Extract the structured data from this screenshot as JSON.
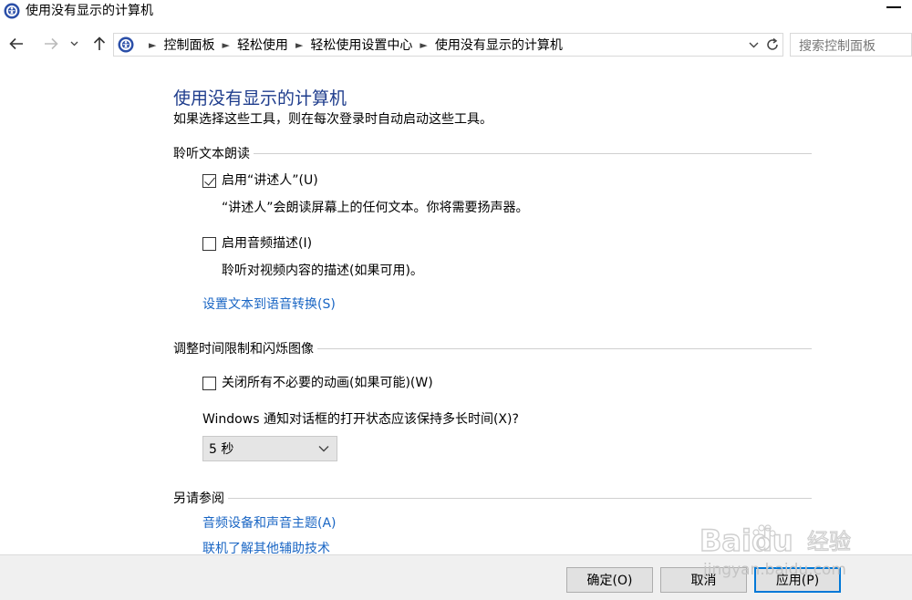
{
  "window": {
    "title": "使用没有显示的计算机"
  },
  "nav": {
    "breadcrumbs": [
      "控制面板",
      "轻松使用",
      "轻松使用设置中心",
      "使用没有显示的计算机"
    ],
    "search_placeholder": "搜索控制面板"
  },
  "page": {
    "title": "使用没有显示的计算机",
    "subtitle": "如果选择这些工具，则在每次登录时自动启动这些工具。"
  },
  "sections": {
    "hear": {
      "heading": "聆听文本朗读",
      "narrator_label": "启用“讲述人”(U)",
      "narrator_checked": true,
      "narrator_desc": "“讲述人”会朗读屏幕上的任何文本。你将需要扬声器。",
      "audio_desc_label": "启用音频描述(I)",
      "audio_desc_checked": false,
      "audio_desc_desc": "聆听对视频内容的描述(如果可用)。",
      "tts_link": "设置文本到语音转换(S)"
    },
    "timing": {
      "heading": "调整时间限制和闪烁图像",
      "animations_label": "关闭所有不必要的动画(如果可能)(W)",
      "animations_checked": false,
      "notify_question": "Windows 通知对话框的打开状态应该保持多长时间(X)?",
      "notify_value": "5 秒"
    },
    "see_also": {
      "heading": "另请参阅",
      "link1": "音频设备和声音主题(A)",
      "link2": "联机了解其他辅助技术"
    }
  },
  "buttons": {
    "ok": "确定(O)",
    "cancel": "取消",
    "apply": "应用(P)"
  },
  "watermark": {
    "brand": "Baidu",
    "brand_cn": "经验",
    "url": "jingyan.baidu.com"
  },
  "colors": {
    "title_blue": "#1e3c8c",
    "link_blue": "#1a66c4",
    "accent": "#0078d7"
  }
}
